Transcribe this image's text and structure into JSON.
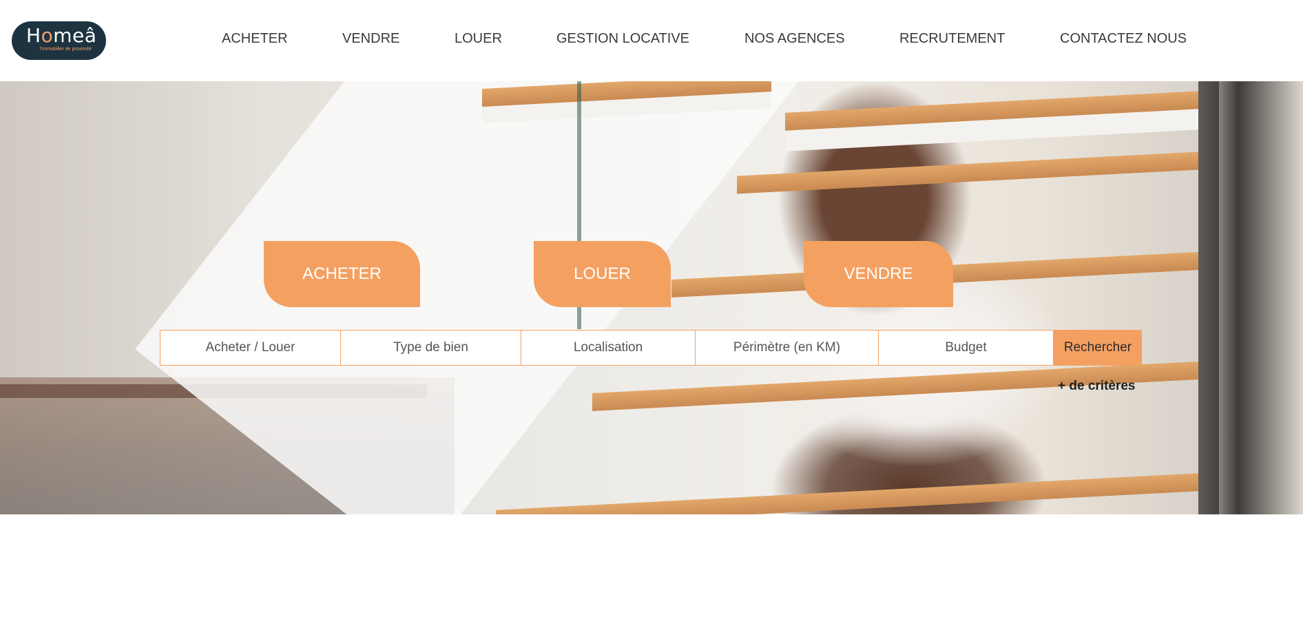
{
  "header": {
    "logo": {
      "word_start": "H",
      "word_accent": "o",
      "word_end": "meâ",
      "tagline": "l'immobilier de proximité"
    },
    "nav": [
      {
        "label": "ACHETER"
      },
      {
        "label": "VENDRE"
      },
      {
        "label": "LOUER"
      },
      {
        "label": "GESTION LOCATIVE"
      },
      {
        "label": "NOS AGENCES"
      },
      {
        "label": "RECRUTEMENT"
      },
      {
        "label": "CONTACTEZ NOUS"
      }
    ]
  },
  "hero": {
    "tabs": [
      {
        "label": "ACHETER"
      },
      {
        "label": "LOUER"
      },
      {
        "label": "VENDRE"
      }
    ],
    "search": {
      "fields": [
        {
          "label": "Acheter / Louer"
        },
        {
          "label": "Type de bien"
        },
        {
          "label": "Localisation"
        },
        {
          "label": "Périmètre (en KM)"
        },
        {
          "label": "Budget"
        }
      ],
      "submit_label": "Rechercher",
      "more_label": "+ de critères"
    }
  },
  "colors": {
    "accent": "#f4a061",
    "logo_bg": "#1d3340",
    "nav_text": "#3a3a3a"
  }
}
